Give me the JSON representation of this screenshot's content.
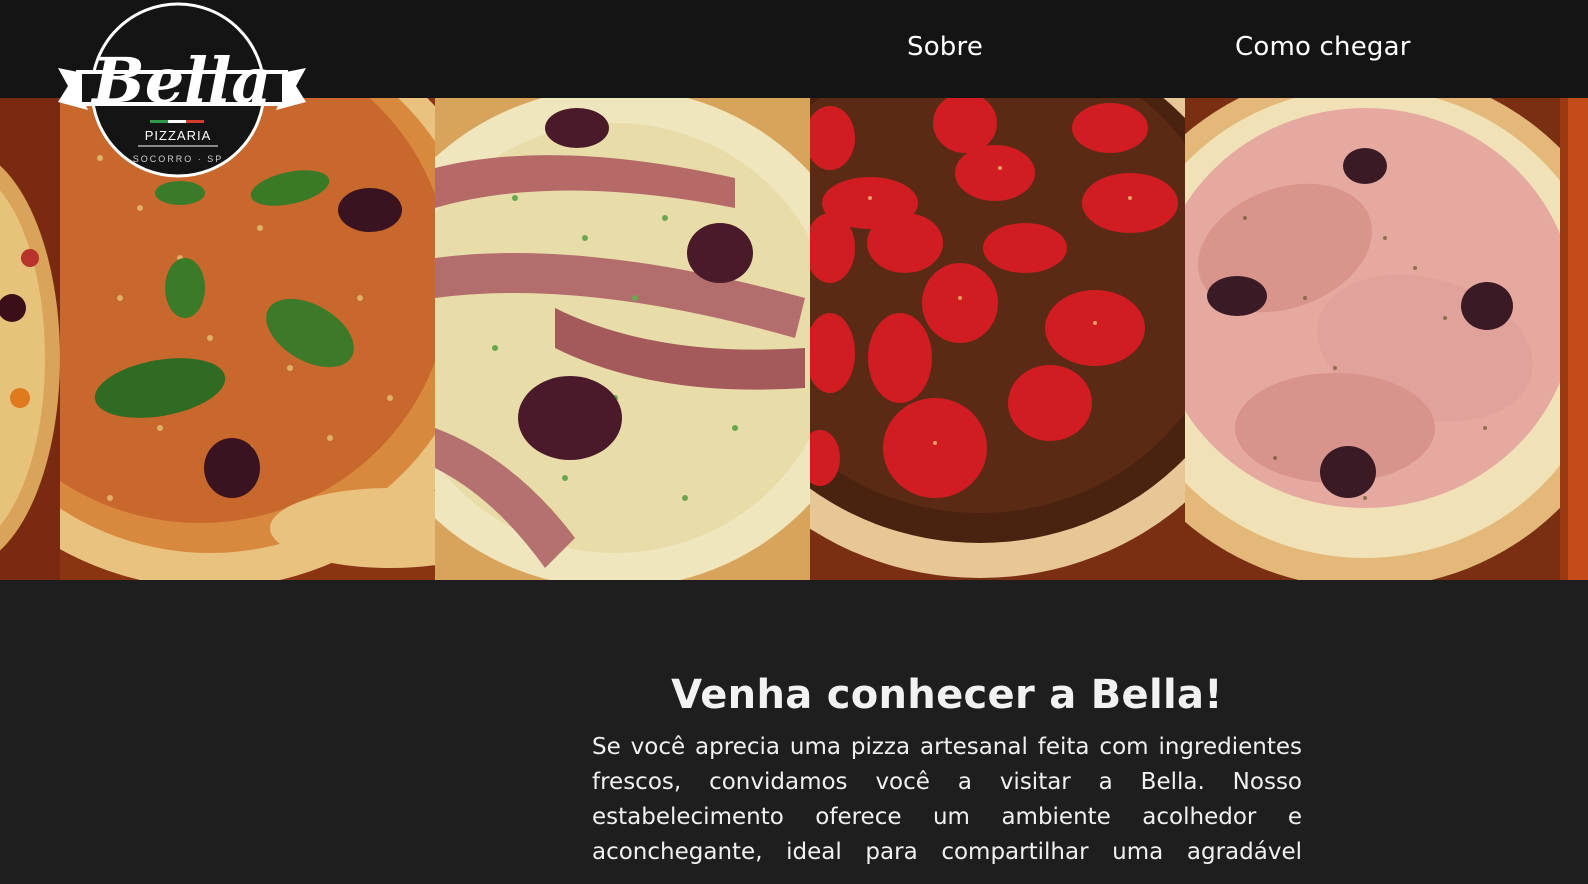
{
  "header": {
    "logo": {
      "name": "Bella",
      "subtitle": "PIZZARIA",
      "location": "SOCORRO · SP"
    },
    "nav": [
      {
        "label": "Sobre"
      },
      {
        "label": "Como chegar"
      }
    ]
  },
  "gallery": {
    "images": [
      {
        "name": "pizza-margherita-image"
      },
      {
        "name": "pizza-bacon-image"
      },
      {
        "name": "pizza-chocolate-strawberry-image"
      },
      {
        "name": "pizza-prosciutto-image"
      }
    ]
  },
  "main": {
    "heading": "Venha conhecer a Bella!",
    "paragraph": "Se você aprecia uma pizza artesanal feita com ingredientes frescos, convidamos você a visitar a Bella. Nosso estabelecimento oferece um ambiente acolhedor e aconchegante, ideal para compartilhar uma agradável"
  },
  "colors": {
    "topbar": "#141414",
    "background": "#1e1e1e",
    "text": "#f2f2f2",
    "accent_green": "#2e9a48",
    "accent_red": "#d63a2f"
  }
}
